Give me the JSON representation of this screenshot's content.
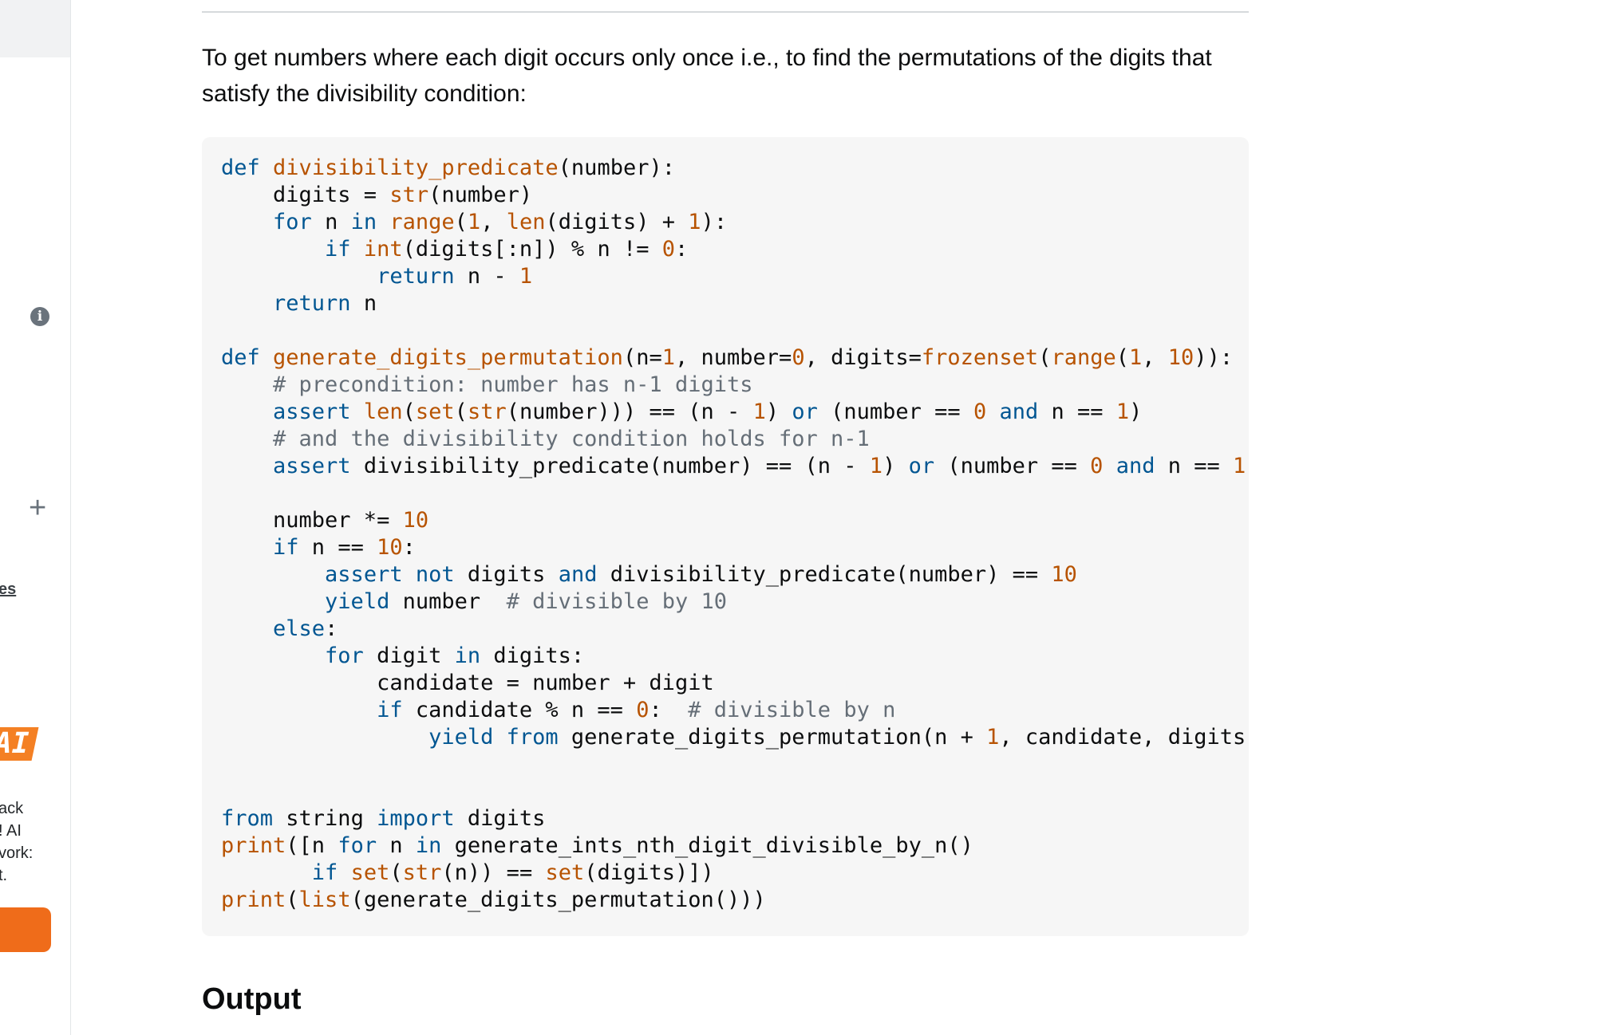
{
  "sidebar": {
    "partial_link": "es",
    "ai_badge": "AI",
    "promo_lines": [
      "ack",
      "! AI",
      "vork:",
      "t."
    ]
  },
  "content": {
    "intro": "To get numbers where each digit occurs only once i.e., to find the permutations of the digits that satisfy the divisibility condition:",
    "output_heading": "Output"
  },
  "code": {
    "language": "python",
    "lines": [
      [
        [
          "kw",
          "def"
        ],
        [
          "t",
          " "
        ],
        [
          "fn",
          "divisibility_predicate"
        ],
        [
          "t",
          "(number):"
        ]
      ],
      [
        [
          "t",
          "    digits = "
        ],
        [
          "bi",
          "str"
        ],
        [
          "t",
          "(number)"
        ]
      ],
      [
        [
          "t",
          "    "
        ],
        [
          "kw",
          "for"
        ],
        [
          "t",
          " n "
        ],
        [
          "kw",
          "in"
        ],
        [
          "t",
          " "
        ],
        [
          "bi",
          "range"
        ],
        [
          "t",
          "("
        ],
        [
          "num",
          "1"
        ],
        [
          "t",
          ", "
        ],
        [
          "bi",
          "len"
        ],
        [
          "t",
          "(digits) + "
        ],
        [
          "num",
          "1"
        ],
        [
          "t",
          "):"
        ]
      ],
      [
        [
          "t",
          "        "
        ],
        [
          "kw",
          "if"
        ],
        [
          "t",
          " "
        ],
        [
          "bi",
          "int"
        ],
        [
          "t",
          "(digits[:n]) % n != "
        ],
        [
          "num",
          "0"
        ],
        [
          "t",
          ":"
        ]
      ],
      [
        [
          "t",
          "            "
        ],
        [
          "kw",
          "return"
        ],
        [
          "t",
          " n - "
        ],
        [
          "num",
          "1"
        ]
      ],
      [
        [
          "t",
          "    "
        ],
        [
          "kw",
          "return"
        ],
        [
          "t",
          " n"
        ]
      ],
      [],
      [
        [
          "kw",
          "def"
        ],
        [
          "t",
          " "
        ],
        [
          "fn",
          "generate_digits_permutation"
        ],
        [
          "t",
          "(n="
        ],
        [
          "num",
          "1"
        ],
        [
          "t",
          ", number="
        ],
        [
          "num",
          "0"
        ],
        [
          "t",
          ", digits="
        ],
        [
          "bi",
          "frozenset"
        ],
        [
          "t",
          "("
        ],
        [
          "bi",
          "range"
        ],
        [
          "t",
          "("
        ],
        [
          "num",
          "1"
        ],
        [
          "t",
          ", "
        ],
        [
          "num",
          "10"
        ],
        [
          "t",
          ")):"
        ]
      ],
      [
        [
          "t",
          "    "
        ],
        [
          "cm",
          "# precondition: number has n-1 digits"
        ]
      ],
      [
        [
          "t",
          "    "
        ],
        [
          "kw",
          "assert"
        ],
        [
          "t",
          " "
        ],
        [
          "bi",
          "len"
        ],
        [
          "t",
          "("
        ],
        [
          "bi",
          "set"
        ],
        [
          "t",
          "("
        ],
        [
          "bi",
          "str"
        ],
        [
          "t",
          "(number))) == (n - "
        ],
        [
          "num",
          "1"
        ],
        [
          "t",
          ") "
        ],
        [
          "kw",
          "or"
        ],
        [
          "t",
          " (number == "
        ],
        [
          "num",
          "0"
        ],
        [
          "t",
          " "
        ],
        [
          "kw",
          "and"
        ],
        [
          "t",
          " n == "
        ],
        [
          "num",
          "1"
        ],
        [
          "t",
          ")"
        ]
      ],
      [
        [
          "t",
          "    "
        ],
        [
          "cm",
          "# and the divisibility condition holds for n-1"
        ]
      ],
      [
        [
          "t",
          "    "
        ],
        [
          "kw",
          "assert"
        ],
        [
          "t",
          " divisibility_predicate(number) == (n - "
        ],
        [
          "num",
          "1"
        ],
        [
          "t",
          ") "
        ],
        [
          "kw",
          "or"
        ],
        [
          "t",
          " (number == "
        ],
        [
          "num",
          "0"
        ],
        [
          "t",
          " "
        ],
        [
          "kw",
          "and"
        ],
        [
          "t",
          " n == "
        ],
        [
          "num",
          "1"
        ],
        [
          "t",
          ")"
        ]
      ],
      [],
      [
        [
          "t",
          "    number *= "
        ],
        [
          "num",
          "10"
        ]
      ],
      [
        [
          "t",
          "    "
        ],
        [
          "kw",
          "if"
        ],
        [
          "t",
          " n == "
        ],
        [
          "num",
          "10"
        ],
        [
          "t",
          ":"
        ]
      ],
      [
        [
          "t",
          "        "
        ],
        [
          "kw",
          "assert"
        ],
        [
          "t",
          " "
        ],
        [
          "kw",
          "not"
        ],
        [
          "t",
          " digits "
        ],
        [
          "kw",
          "and"
        ],
        [
          "t",
          " divisibility_predicate(number) == "
        ],
        [
          "num",
          "10"
        ]
      ],
      [
        [
          "t",
          "        "
        ],
        [
          "kw",
          "yield"
        ],
        [
          "t",
          " number  "
        ],
        [
          "cm",
          "# divisible by 10"
        ]
      ],
      [
        [
          "t",
          "    "
        ],
        [
          "kw",
          "else"
        ],
        [
          "t",
          ":"
        ]
      ],
      [
        [
          "t",
          "        "
        ],
        [
          "kw",
          "for"
        ],
        [
          "t",
          " digit "
        ],
        [
          "kw",
          "in"
        ],
        [
          "t",
          " digits:"
        ]
      ],
      [
        [
          "t",
          "            candidate = number + digit"
        ]
      ],
      [
        [
          "t",
          "            "
        ],
        [
          "kw",
          "if"
        ],
        [
          "t",
          " candidate % n == "
        ],
        [
          "num",
          "0"
        ],
        [
          "t",
          ":  "
        ],
        [
          "cm",
          "# divisible by n"
        ]
      ],
      [
        [
          "t",
          "                "
        ],
        [
          "kw",
          "yield"
        ],
        [
          "t",
          " "
        ],
        [
          "kw",
          "from"
        ],
        [
          "t",
          " generate_digits_permutation(n + "
        ],
        [
          "num",
          "1"
        ],
        [
          "t",
          ", candidate, digits -"
        ]
      ],
      [],
      [],
      [
        [
          "kw",
          "from"
        ],
        [
          "t",
          " string "
        ],
        [
          "kw",
          "import"
        ],
        [
          "t",
          " digits"
        ]
      ],
      [
        [
          "bi",
          "print"
        ],
        [
          "t",
          "([n "
        ],
        [
          "kw",
          "for"
        ],
        [
          "t",
          " n "
        ],
        [
          "kw",
          "in"
        ],
        [
          "t",
          " generate_ints_nth_digit_divisible_by_n()"
        ]
      ],
      [
        [
          "t",
          "       "
        ],
        [
          "kw",
          "if"
        ],
        [
          "t",
          " "
        ],
        [
          "bi",
          "set"
        ],
        [
          "t",
          "("
        ],
        [
          "bi",
          "str"
        ],
        [
          "t",
          "(n)) == "
        ],
        [
          "bi",
          "set"
        ],
        [
          "t",
          "(digits)])"
        ]
      ],
      [
        [
          "bi",
          "print"
        ],
        [
          "t",
          "("
        ],
        [
          "bi",
          "list"
        ],
        [
          "t",
          "(generate_digits_permutation()))"
        ]
      ]
    ]
  },
  "colors": {
    "keyword": "#015692",
    "function": "#b75301",
    "number": "#b75301",
    "comment": "#656e77",
    "code_background": "#f6f6f6",
    "accent": "#f48024"
  }
}
